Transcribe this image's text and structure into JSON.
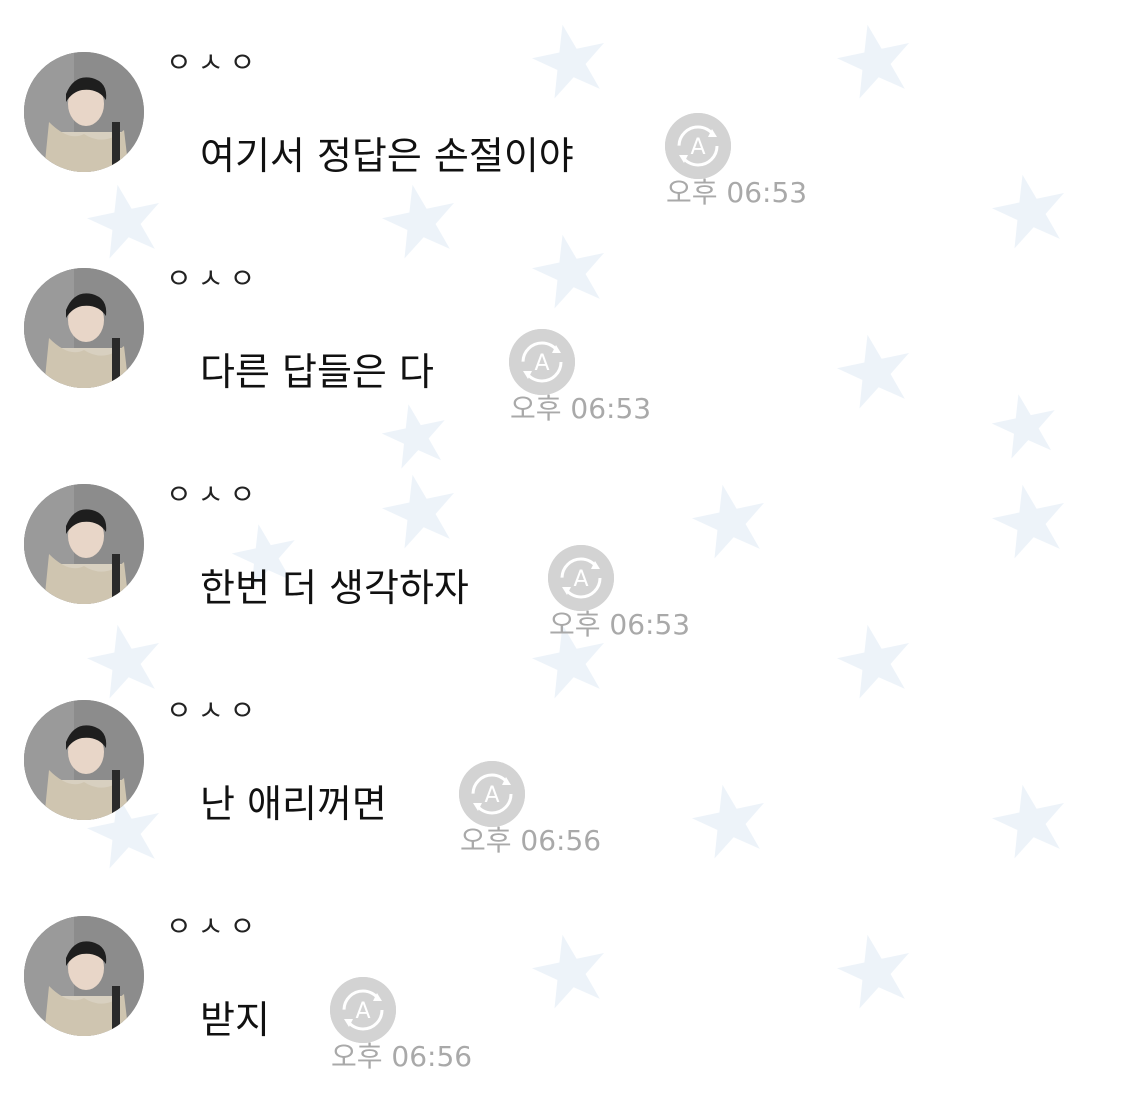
{
  "colors": {
    "background": "#ffffff",
    "star": "#dce8f5",
    "time": "#a9a9a9",
    "read_badge": "#d3d3d3"
  },
  "icons": {
    "background": "star-icon",
    "avatar": "profile-photo",
    "read_status": "auto-translate-icon"
  },
  "read_badge_letter": "A",
  "messages": [
    {
      "sender": "ㅇㅅㅇ",
      "text": "여기서 정답은 손절이야",
      "time": "오후 06:53"
    },
    {
      "sender": "ㅇㅅㅇ",
      "text": "다른 답들은 다",
      "time": "오후 06:53"
    },
    {
      "sender": "ㅇㅅㅇ",
      "text": "한번 더 생각하자",
      "time": "오후 06:53"
    },
    {
      "sender": "ㅇㅅㅇ",
      "text": "난 애리꺼면",
      "time": "오후 06:56"
    },
    {
      "sender": "ㅇㅅㅇ",
      "text": "받지",
      "time": "오후 06:56"
    }
  ]
}
